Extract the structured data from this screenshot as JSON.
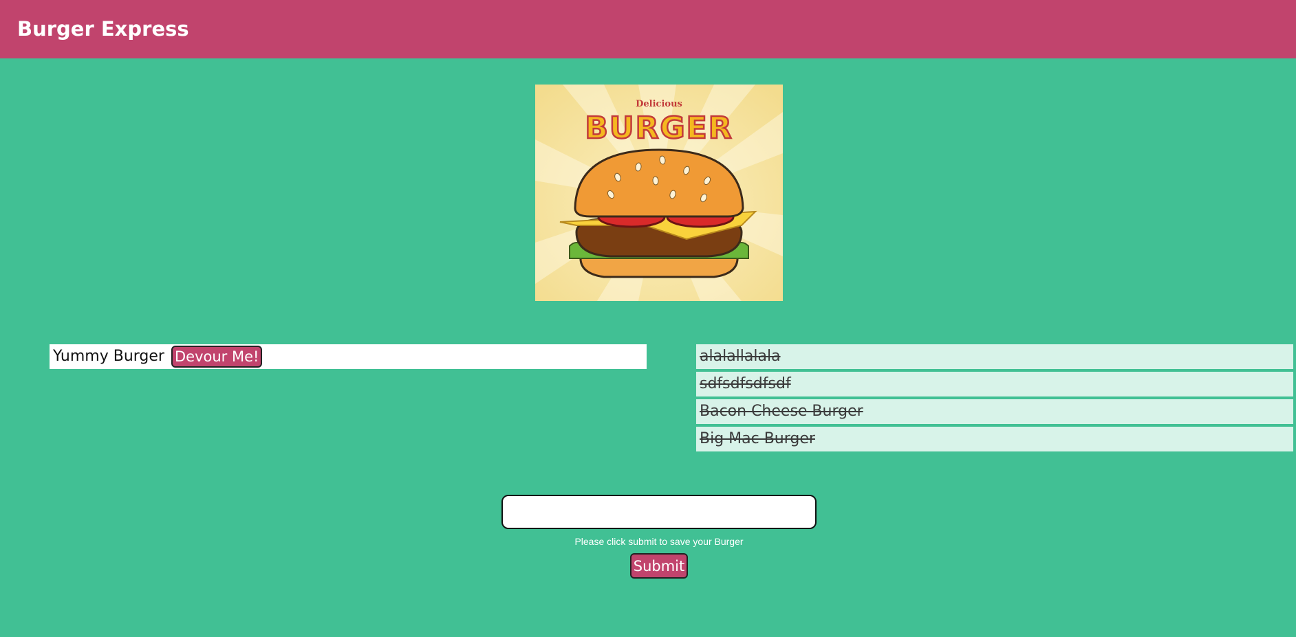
{
  "header": {
    "brand": "Burger Express",
    "accent_color": "#c1446d"
  },
  "hero": {
    "tagline": "Delicious",
    "title": "BURGER"
  },
  "uneaten_burgers": [
    {
      "name": "Yummy Burger",
      "button_label": "Devour Me!"
    }
  ],
  "devoured_burgers": [
    {
      "name": "alalallalala"
    },
    {
      "name": "sdfsdfsdfsdf"
    },
    {
      "name": "Bacon Cheese Burger"
    },
    {
      "name": "Big Mac Burger"
    }
  ],
  "form": {
    "input_value": "",
    "input_placeholder": "",
    "help_text": "Please click submit to save your Burger",
    "submit_label": "Submit"
  },
  "colors": {
    "background": "#41c094",
    "devoured_row": "#d8f3e9"
  }
}
